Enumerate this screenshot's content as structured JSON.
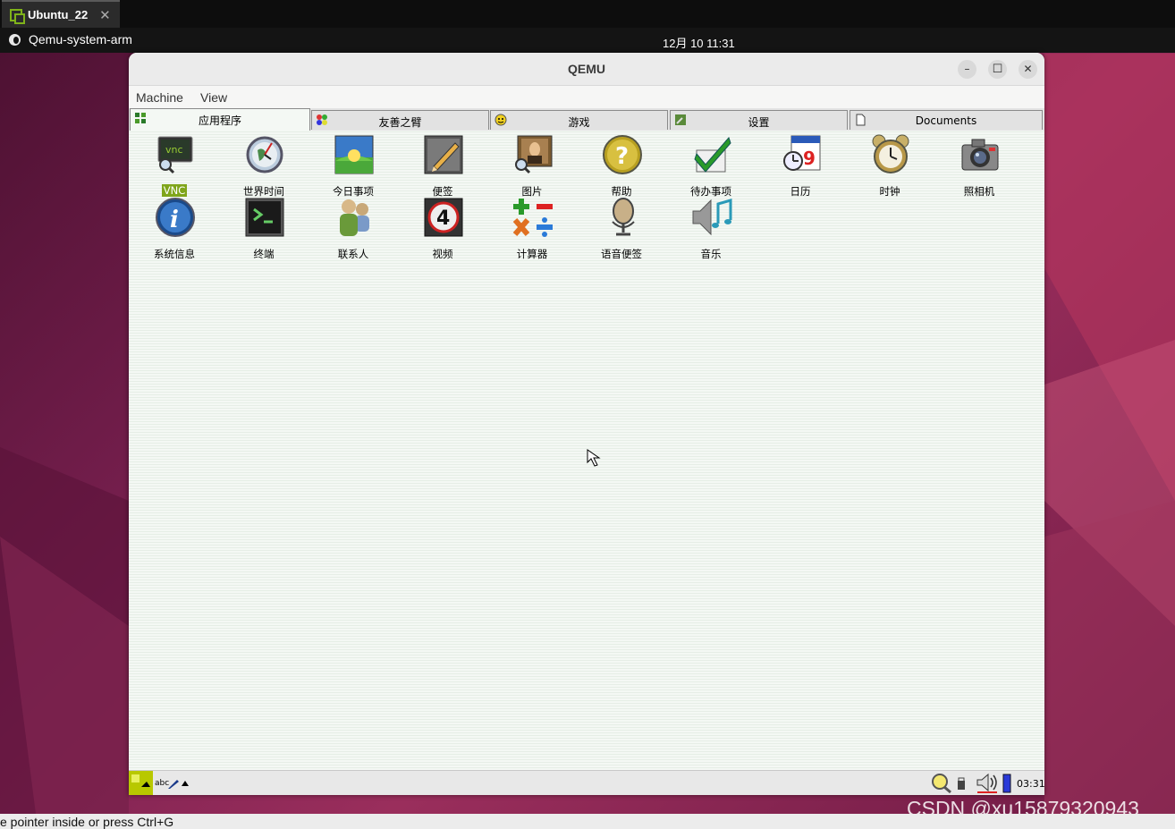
{
  "vbox_tab": {
    "label": "Ubuntu_22",
    "close": "✕"
  },
  "panel": {
    "app_name": "Qemu-system-arm",
    "clock": "12月 10  11:31"
  },
  "window": {
    "title": "QEMU",
    "minimize": "–",
    "maximize": "☐",
    "close": "✕"
  },
  "menu": {
    "machine": "Machine",
    "view": "View"
  },
  "guest_tabs": [
    {
      "label": "应用程序",
      "icon": "grid-icon"
    },
    {
      "label": "友善之臂",
      "icon": "dots-icon"
    },
    {
      "label": "游戏",
      "icon": "smiley-icon"
    },
    {
      "label": "设置",
      "icon": "wrench-icon"
    },
    {
      "label": "Documents",
      "icon": "document-icon"
    }
  ],
  "apps": [
    {
      "label": "VNC",
      "icon": "vnc-icon",
      "selected": true
    },
    {
      "label": "世界时间",
      "icon": "world-clock-icon"
    },
    {
      "label": "今日事项",
      "icon": "today-icon"
    },
    {
      "label": "便签",
      "icon": "notes-icon"
    },
    {
      "label": "图片",
      "icon": "pictures-icon"
    },
    {
      "label": "帮助",
      "icon": "help-icon"
    },
    {
      "label": "待办事项",
      "icon": "todo-icon"
    },
    {
      "label": "日历",
      "icon": "calendar-icon"
    },
    {
      "label": "时钟",
      "icon": "alarm-clock-icon"
    },
    {
      "label": "照相机",
      "icon": "camera-icon"
    },
    {
      "label": "系统信息",
      "icon": "info-icon"
    },
    {
      "label": "终端",
      "icon": "terminal-icon"
    },
    {
      "label": "联系人",
      "icon": "contacts-icon"
    },
    {
      "label": "视频",
      "icon": "video-icon"
    },
    {
      "label": "计算器",
      "icon": "calculator-icon"
    },
    {
      "label": "语音便签",
      "icon": "microphone-icon"
    },
    {
      "label": "音乐",
      "icon": "music-icon"
    }
  ],
  "calendar_day": "9",
  "video_number": "4",
  "vnc_text": "vnc",
  "taskbar": {
    "input_method": "abc",
    "time": "03:31"
  },
  "status_text": "e pointer inside or press Ctrl+G",
  "watermark": "CSDN @xu15879320943"
}
